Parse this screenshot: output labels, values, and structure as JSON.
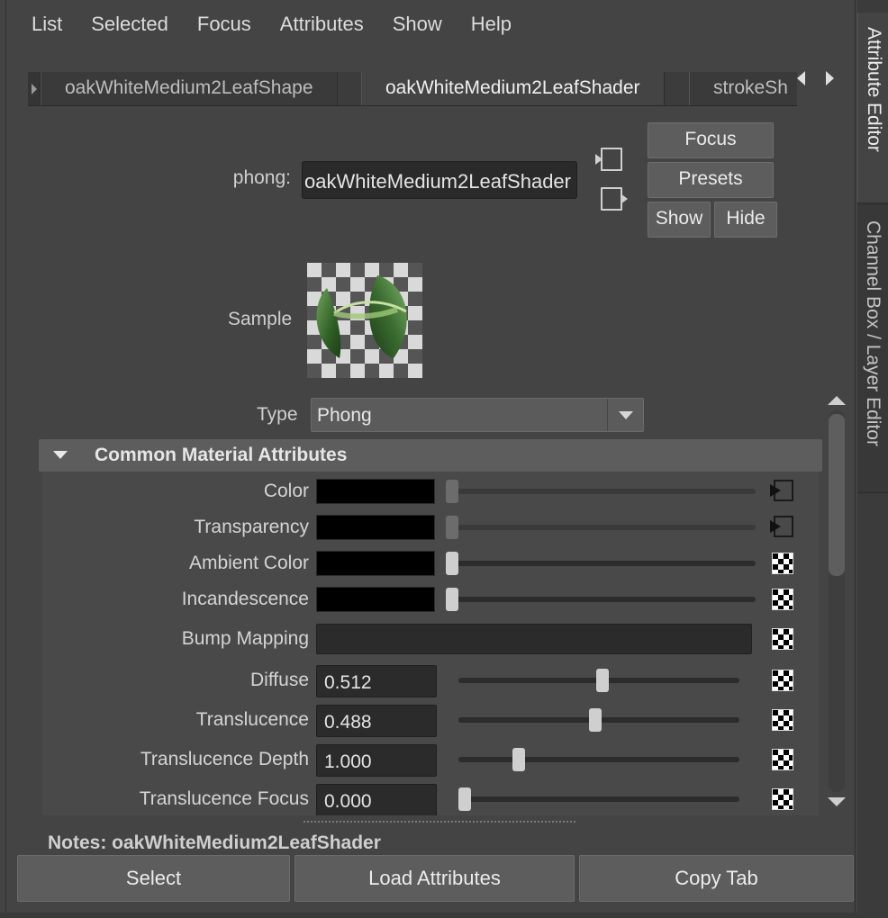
{
  "menu": [
    "List",
    "Selected",
    "Focus",
    "Attributes",
    "Show",
    "Help"
  ],
  "tabs": [
    "oakWhiteMedium2LeafShape",
    "oakWhiteMedium2LeafShader",
    "strokeSh"
  ],
  "shader": {
    "type_label": "phong:",
    "name": "oakWhiteMedium2LeafShader",
    "focus_label": "Focus",
    "presets_label": "Presets",
    "show_label": "Show",
    "hide_label": "Hide"
  },
  "sample_label": "Sample",
  "type": {
    "label": "Type",
    "value": "Phong"
  },
  "section": {
    "title": "Common Material Attributes"
  },
  "color_attrs": [
    {
      "label": "Color",
      "slider": 0.0,
      "map": "input-arrow",
      "dim": true
    },
    {
      "label": "Transparency",
      "slider": 0.0,
      "map": "input-arrow",
      "dim": true
    },
    {
      "label": "Ambient Color",
      "slider": 0.0,
      "map": "checker",
      "dim": false
    },
    {
      "label": "Incandescence",
      "slider": 0.0,
      "map": "checker",
      "dim": false
    }
  ],
  "bump": {
    "label": "Bump Mapping"
  },
  "num_attrs": [
    {
      "label": "Diffuse",
      "value": "0.512",
      "slider": 0.512
    },
    {
      "label": "Translucence",
      "value": "0.488",
      "slider": 0.488
    },
    {
      "label": "Translucence Depth",
      "value": "1.000",
      "slider": 0.2
    },
    {
      "label": "Translucence Focus",
      "value": "0.000",
      "slider": 0.0
    }
  ],
  "notes": "Notes:  oakWhiteMedium2LeafShader",
  "buttons": {
    "select": "Select",
    "load": "Load Attributes",
    "copy": "Copy Tab"
  },
  "side_tabs": {
    "attribute_editor": "Attribute Editor",
    "channel_box": "Channel Box / Layer Editor"
  }
}
